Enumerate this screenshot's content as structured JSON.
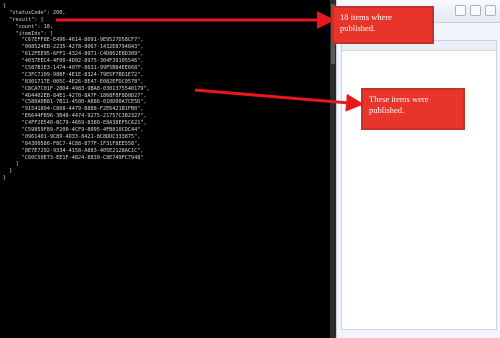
{
  "console": {
    "lines": [
      "{",
      "  \"statusCode\": 200,",
      "  \"result\": {",
      "    \"count\": 18,",
      "    \"itemIds\": [",
      "      \"C67EFF8E-E496-4614-8091-9E9527D58CF7\",",
      "      \"008524EB-2235-4278-8067-1432E8794843\",",
      "      \"612FEE95-6FF1-4324-8071-C4D862E8D309\",",
      "      \"4037EEC4-4F00-4D02-8975-304F39105546\",",
      "      \"C587B1E3-1474-407F-8631-99F5B84EE668\",",
      "      \"C3FC7109-98BF-4E1E-8324-79E5F7BD1E72\",",
      "      \"8301717E-005C-4E26-8E47-E082EFDC0578\",",
      "      \"C8CA7C01F-20D4-4983-9BA8-0301375540179\",",
      "      \"4D4402EB-84E1-4270-8A7F-1868F8F8D0D27\",",
      "      \"C580A0B81-7B11-4500-A886-010D00A7CE5D\",",
      "      \"91541804-C868-4479-8888-F2E6421B1FB0\",",
      "      \"E6644FB96-3B48-4474-9275-21757C3B2327\",",
      "      \"C4FF2E540-BC79-4669-8380-E8A38EF5C621\",",
      "      \"C59859F89-F200-4CF9-B095-4FB810CDC44\",",
      "      \"0961401-9C89-4D33-8421-8C8DDC333875\",",
      "      \"84300586-F8C7-4C88-877F-1F31F8EE558\",",
      "      \"0E7E7292-9334-4158-A883-405E2128AC1C\",",
      "      \"C60C50E73-EE1F-4824-8839-C8E749FC7948\"",
      "    ]",
      "  }",
      "}"
    ]
  },
  "callouts": {
    "top_text": "18 items where published.",
    "middle_text": "These items were published."
  },
  "colors": {
    "console_bg": "#000000",
    "console_text": "#d6d6d6",
    "callout_fill": "#e8342a",
    "arrow": "#e8171c"
  }
}
